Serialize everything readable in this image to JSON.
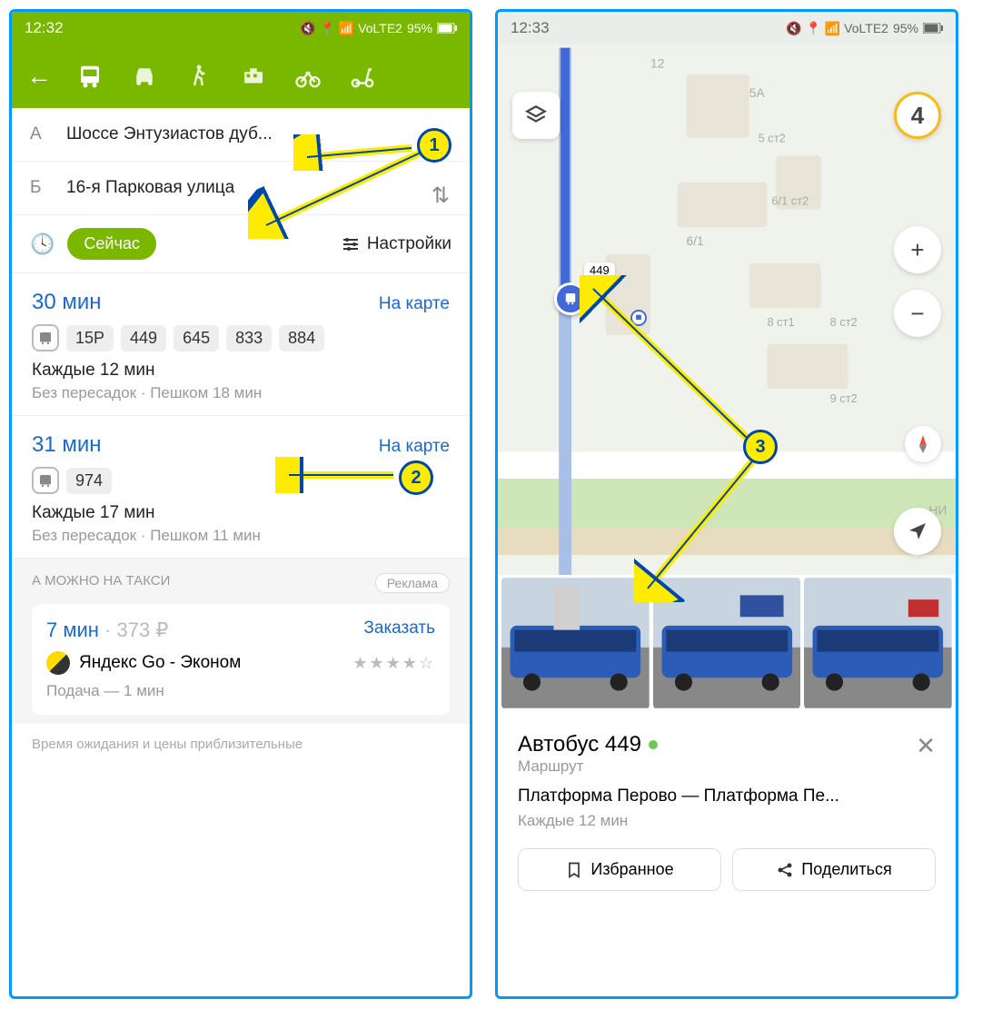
{
  "phone1": {
    "status": {
      "time": "12:32",
      "battery": "95%",
      "extra": "🔇 📍 📶 VoLTE2"
    },
    "route": {
      "from_letter": "А",
      "from": "Шоссе Энтузиастов дуб...",
      "to_letter": "Б",
      "to": "16-я Парковая улица"
    },
    "timebar": {
      "now": "Сейчас",
      "settings": "Настройки"
    },
    "result1": {
      "time": "30 мин",
      "maplink": "На карте",
      "buses": [
        "15Р",
        "449",
        "645",
        "833",
        "884"
      ],
      "freq": "Каждые 12 мин",
      "detail": "Без пересадок  ·  Пешком 18 мин"
    },
    "result2": {
      "time": "31 мин",
      "maplink": "На карте",
      "buses": [
        "974"
      ],
      "freq": "Каждые 17 мин",
      "detail": "Без пересадок  ·  Пешком 11 мин"
    },
    "taxi": {
      "header": "А МОЖНО НА ТАКСИ",
      "ad": "Реклама",
      "time": "7 мин",
      "price": "373 ₽",
      "order": "Заказать",
      "name": "Яндекс Go - Эконом",
      "stars": "★★★★☆",
      "eta": "Подача — 1 мин"
    },
    "disclaimer": "Время ожидания и цены приблизительные"
  },
  "phone2": {
    "status": {
      "time": "12:33",
      "battery": "95%",
      "extra": "🔇 📍 📶 VoLTE2"
    },
    "badge": "4",
    "stop_label": "449",
    "map_labels": {
      "l1": "12",
      "l2": "5А",
      "l3": "5 ст2",
      "l4": "6/1 ст2",
      "l5": "6/1",
      "l6": "8 ст2",
      "l7": "8 ст1",
      "l8": "9 ст2",
      "l9": "НИ"
    },
    "card": {
      "title": "Автобус 449",
      "subtitle": "Маршрут",
      "route": "Платформа Перово — Платформа Пе...",
      "freq": "Каждые 12 мин",
      "fav": "Избранное",
      "share": "Поделиться"
    }
  },
  "anno": {
    "n1": "1",
    "n2": "2",
    "n3": "3"
  }
}
